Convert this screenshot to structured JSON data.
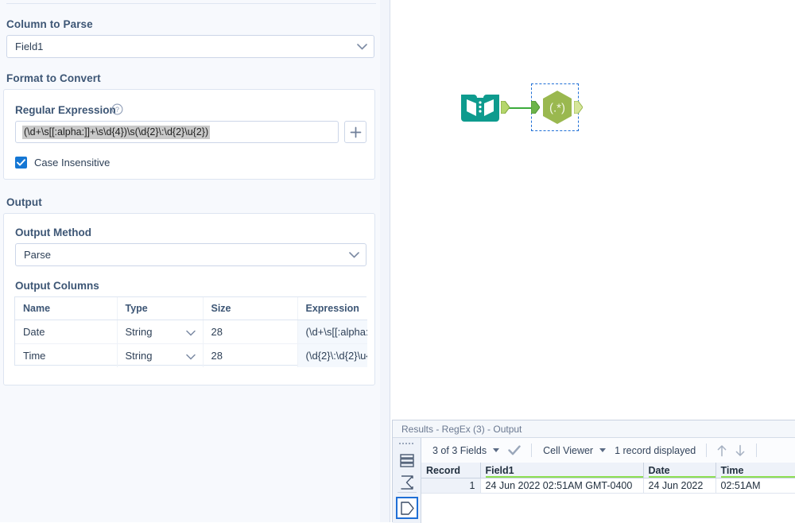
{
  "config": {
    "column_to_parse": {
      "label": "Column to Parse",
      "value": "Field1"
    },
    "format_to_convert": {
      "label": "Format to Convert",
      "regex_label": "Regular Expression",
      "regex_value": "(\\d+\\s[[:alpha:]]+\\s\\d{4})\\s(\\d{2}\\:\\d{2}\\u{2})",
      "add_button": "+",
      "case_insensitive_label": "Case Insensitive",
      "case_insensitive_checked": "✔"
    },
    "output": {
      "label": "Output",
      "method_label": "Output Method",
      "method_value": "Parse",
      "columns_label": "Output Columns",
      "headers": [
        "Name",
        "Type",
        "Size",
        "Expression"
      ],
      "rows": [
        {
          "name": "Date",
          "type": "String",
          "size": "28",
          "expression": "(\\d+\\s[[:alpha:..."
        },
        {
          "name": "Time",
          "type": "String",
          "size": "28",
          "expression": "(\\d{2}\\:\\d{2}\\u{..."
        }
      ]
    }
  },
  "canvas": {
    "nodes": [
      {
        "id": "input-data",
        "label": "",
        "icon": "book-icon"
      },
      {
        "id": "regex",
        "label": "(.*)",
        "icon": "regex-hexagon-icon",
        "selected": true
      }
    ]
  },
  "results": {
    "title": "Results - RegEx (3) - Output",
    "toolbar": {
      "fields_label": "3 of 3 Fields",
      "check_icon": "✔",
      "viewer_label": "Cell Viewer",
      "record_count_label": "1 record displayed",
      "up_arrow": "↑",
      "down_arrow": "↓"
    },
    "rail": {
      "items": [
        {
          "name": "records-icon",
          "selected": false
        },
        {
          "name": "summary-sigma-icon",
          "selected": false
        },
        {
          "name": "data-shape-icon",
          "selected": true
        }
      ]
    },
    "grid": {
      "headers": [
        "Record",
        "Field1",
        "Date",
        "Time"
      ],
      "rows": [
        {
          "record": "1",
          "field1": "24 Jun 2022 02:51AM GMT-0400",
          "date": "24 Jun 2022",
          "time": "02:51AM"
        }
      ]
    }
  },
  "colors": {
    "panel_bg": "#f7f9fd",
    "accent_blue": "#1577d4",
    "selection_blue": "#1f6fd6",
    "node_teal": "#0e9b8e",
    "node_olive": "#9ab84f",
    "connector_green": "#3bab3b",
    "type_bar_green": "#8ddf52"
  }
}
